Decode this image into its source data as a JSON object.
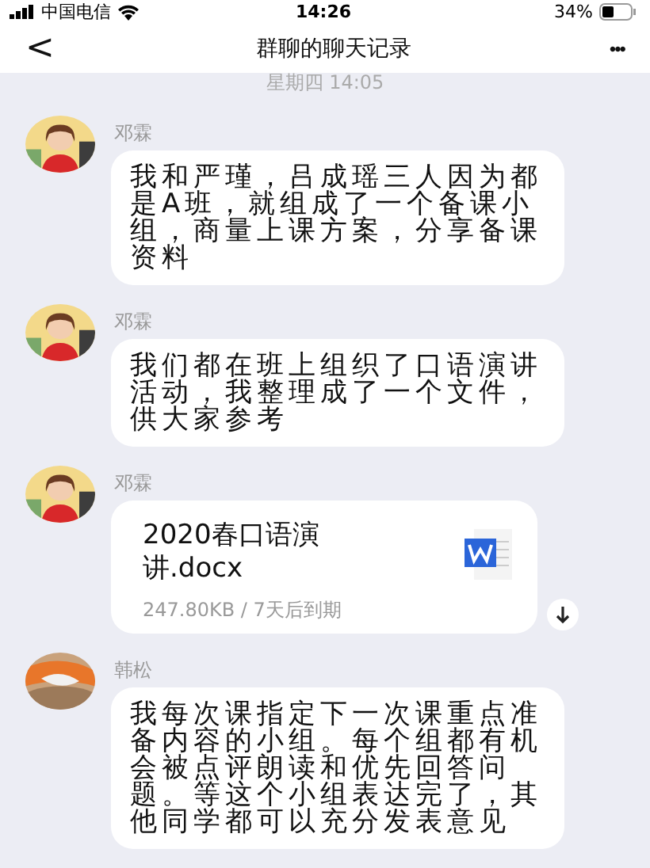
{
  "status_bar": {
    "carrier": "中国电信",
    "time": "14:26",
    "battery": "34%"
  },
  "nav": {
    "back": "<",
    "title": "群聊的聊天记录",
    "more": "•••"
  },
  "timestamp": "星期四 14:05",
  "messages": [
    {
      "kind": "text",
      "sender": "邓霖",
      "text": "我和严瑾，吕成瑶三人因为都是A班，就组成了一个备课小组，商量上课方案，分享备课资料"
    },
    {
      "kind": "text",
      "sender": "邓霖",
      "text": "我们都在班上组织了口语演讲活动，我整理成了一个文件，供大家参考"
    },
    {
      "kind": "file",
      "sender": "邓霖",
      "file_name": "2020春口语演讲.docx",
      "file_info": "247.80KB / 7天后到期"
    },
    {
      "kind": "text",
      "sender": "韩松",
      "text": "我每次课指定下一次课重点准备内容的小组。每个组都有机会被点评朗读和优先回答问题。等这个小组表达完了，其他同学都可以充分发表意见"
    }
  ]
}
